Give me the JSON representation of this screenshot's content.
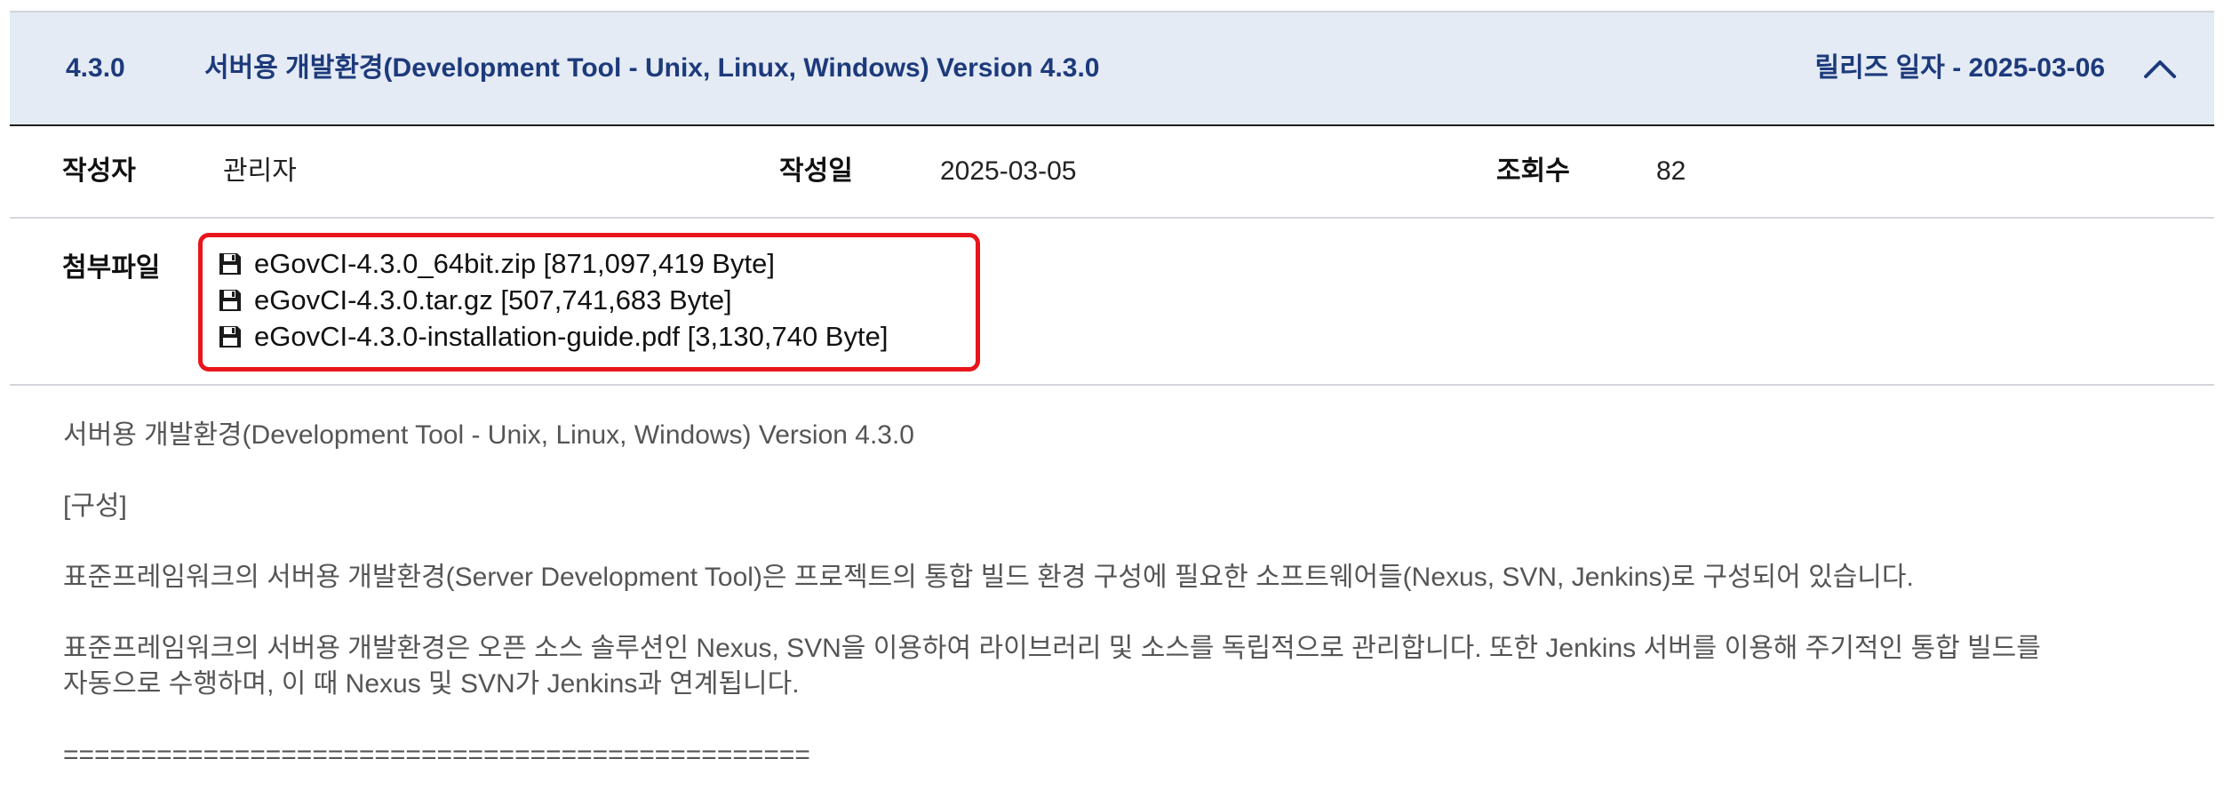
{
  "release": {
    "version": "4.3.0",
    "title": "서버용 개발환경(Development Tool - Unix, Linux, Windows) Version 4.3.0",
    "release_date": "릴리즈 일자 - 2025-03-06"
  },
  "meta": {
    "author_label": "작성자",
    "author": "관리자",
    "created_label": "작성일",
    "created": "2025-03-05",
    "views_label": "조회수",
    "views": "82"
  },
  "attachments": {
    "label": "첨부파일",
    "highlight_color": "#e8151b",
    "files": [
      {
        "name": "eGovCI-4.3.0_64bit.zip [871,097,419 Byte]",
        "icon": "floppy-disk-icon"
      },
      {
        "name": "eGovCI-4.3.0.tar.gz [507,741,683 Byte]",
        "icon": "floppy-disk-icon"
      },
      {
        "name": "eGovCI-4.3.0-installation-guide.pdf [3,130,740 Byte]",
        "icon": "floppy-disk-icon"
      }
    ]
  },
  "content": {
    "line1": "서버용 개발환경(Development Tool - Unix, Linux, Windows) Version 4.3.0",
    "line2": "[구성]",
    "line3": "표준프레임워크의 서버용 개발환경(Server Development Tool)은 프로젝트의 통합 빌드 환경 구성에 필요한 소프트웨어들(Nexus, SVN, Jenkins)로 구성되어 있습니다.",
    "line4": "표준프레임워크의 서버용 개발환경은 오픈 소스 솔루션인 Nexus, SVN을 이용하여 라이브러리 및 소스를 독립적으로 관리합니다. 또한 Jenkins 서버를 이용해 주기적인 통합 빌드를",
    "line5": "자동으로 수행하며, 이 때 Nexus 및 SVN가 Jenkins과 연계됩니다.",
    "line6": "================================================"
  },
  "colors": {
    "header_bg": "#e4ebf5",
    "header_text": "#1d3a7b"
  }
}
